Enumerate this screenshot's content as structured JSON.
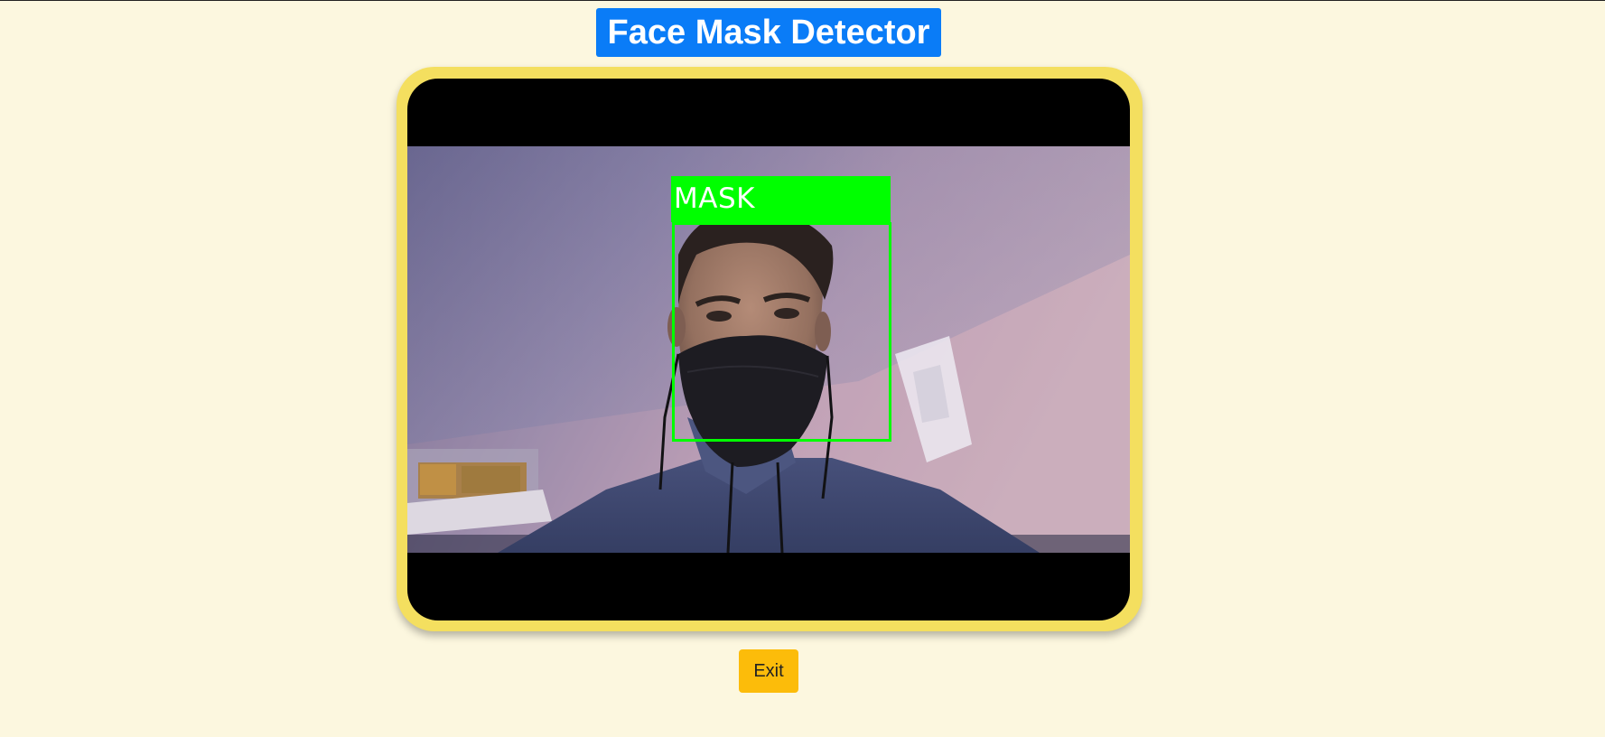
{
  "page": {
    "title": "Face Mask Detector"
  },
  "video": {
    "detection": {
      "label": "MASK",
      "color": "#00ff00"
    }
  },
  "controls": {
    "exit_label": "Exit"
  },
  "colors": {
    "background": "#fcf7df",
    "title_background": "#0a7cf7",
    "frame_border": "#f4df5f",
    "exit_button": "#fcbc0a"
  }
}
